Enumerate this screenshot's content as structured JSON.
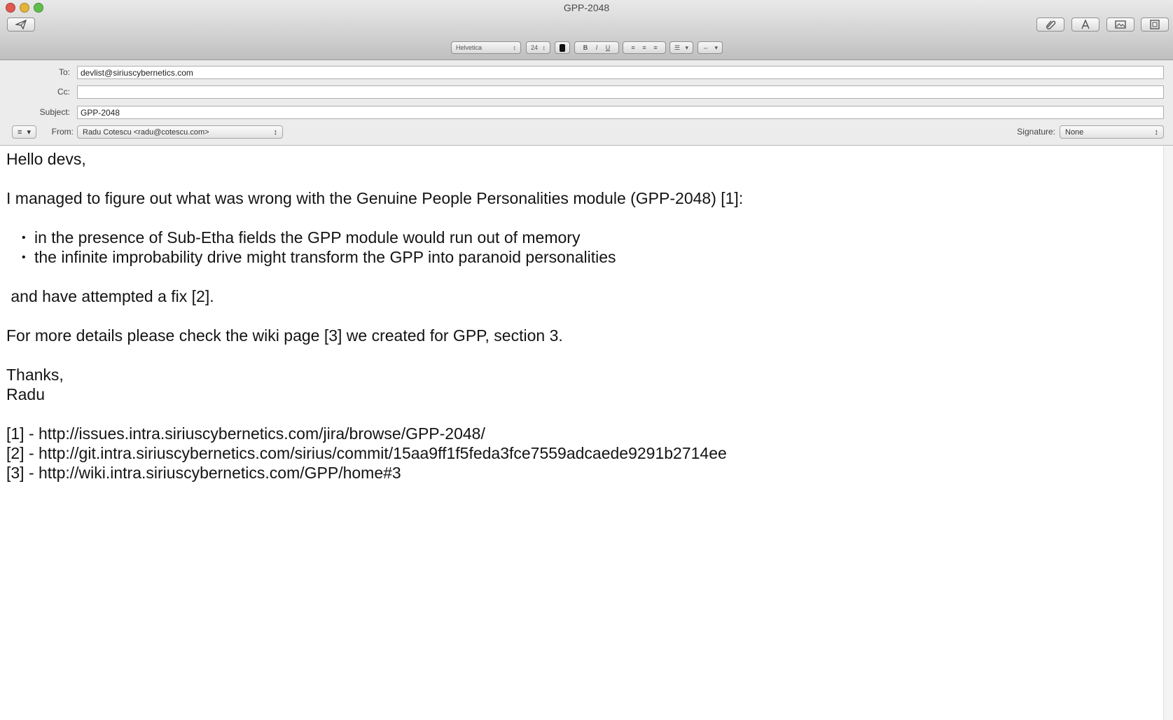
{
  "window": {
    "title": "GPP-2048"
  },
  "toolbar": {
    "send_icon": "paper-plane-icon",
    "right_icons": [
      "paperclip-icon",
      "font-icon",
      "photo-browser-icon",
      "stationery-icon"
    ]
  },
  "formatbar": {
    "font_family": "Helvetica",
    "font_size": "24",
    "bold": "B",
    "italic": "I",
    "underline": "U"
  },
  "headers": {
    "to_label": "To:",
    "to_value": "devlist@siriuscybernetics.com",
    "cc_label": "Cc:",
    "cc_value": "",
    "subject_label": "Subject:",
    "subject_value": "GPP-2048",
    "from_label": "From:",
    "from_value": "Radu Cotescu <radu@cotescu.com>",
    "signature_label": "Signature:",
    "signature_value": "None"
  },
  "message": {
    "greeting": "Hello devs,",
    "intro": "I managed to figure out what was wrong with the Genuine People Personalities module (GPP-2048) [1]:",
    "bullets": [
      "in the presence of Sub-Etha fields the GPP module would run out of memory",
      "the infinite improbability drive might transform the GPP into paranoid personalities"
    ],
    "fix_line": " and have attempted a fix [2].",
    "details_line": "For more details please check the wiki page [3] we created for GPP, section 3.",
    "closing": "Thanks,",
    "signature_name": "Radu",
    "references": [
      "[1] - http://issues.intra.siriuscybernetics.com/jira/browse/GPP-2048/",
      "[2] - http://git.intra.siriuscybernetics.com/sirius/commit/15aa9ff1f5feda3fce7559adcaede9291b2714ee",
      "[3] - http://wiki.intra.siriuscybernetics.com/GPP/home#3"
    ]
  }
}
